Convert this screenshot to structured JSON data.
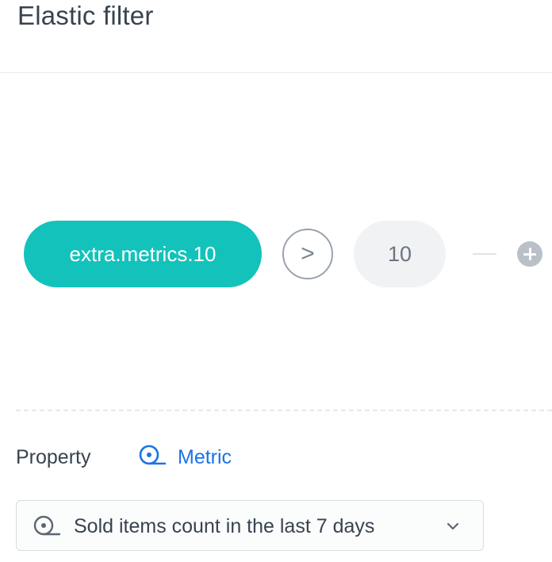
{
  "header": {
    "title": "Elastic filter"
  },
  "filter": {
    "property_label": "extra.metrics.10",
    "operator": ">",
    "value": "10",
    "add_icon": "plus-icon"
  },
  "property_section": {
    "label": "Property",
    "mode_label": "Metric",
    "mode_icon": "metric-icon",
    "select": {
      "value": "Sold items count in the last 7 days",
      "icon": "metric-icon",
      "chevron_icon": "chevron-down-icon"
    }
  },
  "colors": {
    "accent_teal": "#13c2bb",
    "link_blue": "#1a73e8",
    "text_dark": "#384350"
  }
}
